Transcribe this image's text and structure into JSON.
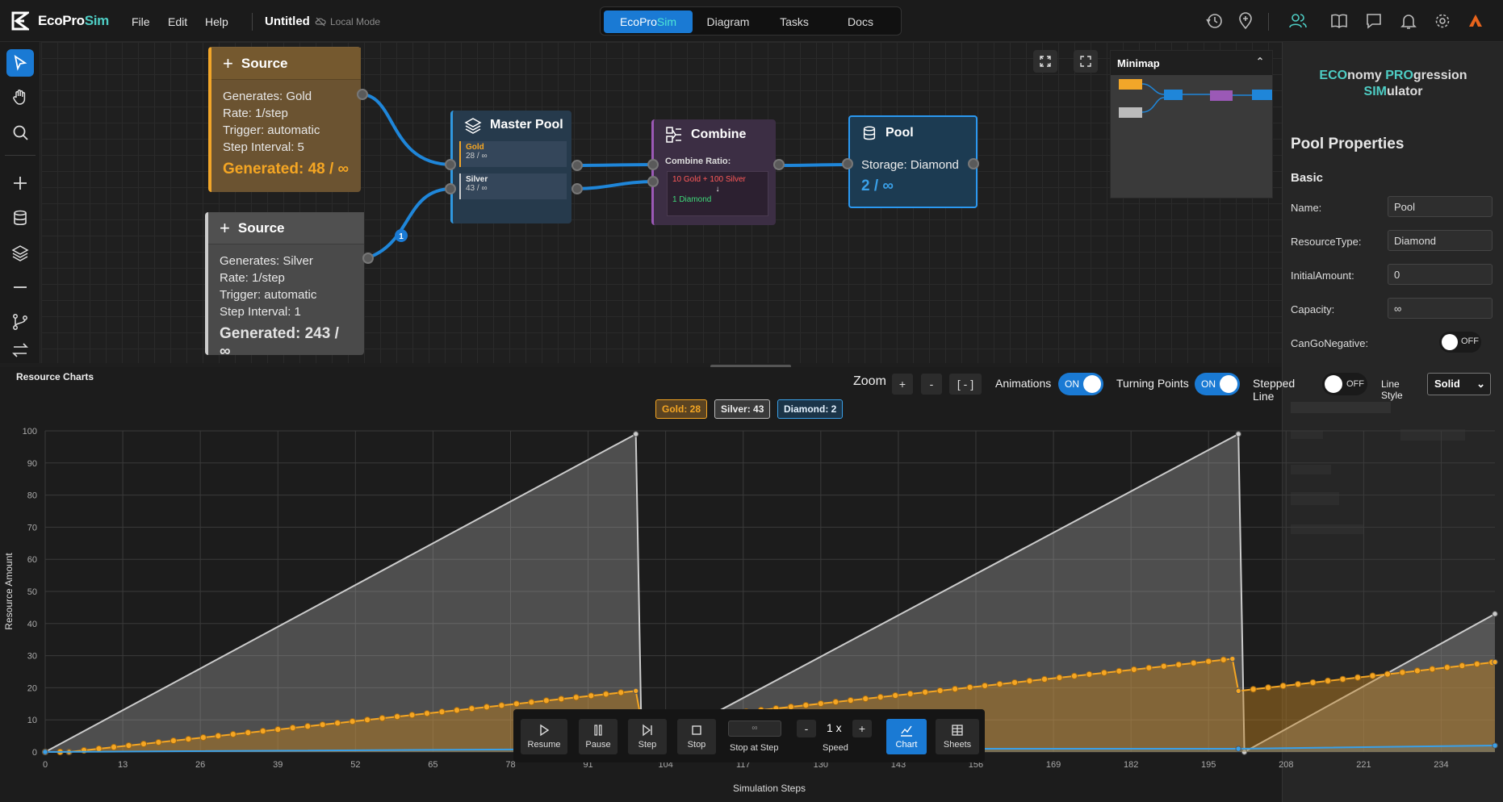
{
  "brand": {
    "name_a": "EcoPro",
    "name_b": "Sim"
  },
  "menu": [
    "File",
    "Edit",
    "Help"
  ],
  "document": {
    "title": "Untitled",
    "mode": "Local Mode"
  },
  "tabs": [
    {
      "label_a": "EcoPro",
      "label_b": "Sim",
      "active": true
    },
    {
      "label": "Diagram"
    },
    {
      "label": "Tasks"
    },
    {
      "label": "Docs"
    }
  ],
  "top_icons": [
    "history-icon",
    "location-icon",
    "users-icon",
    "book-icon",
    "chat-icon",
    "bell-icon",
    "settings-icon",
    "avatar-icon"
  ],
  "left_tools": [
    "pointer-icon",
    "hand-icon",
    "search-icon",
    "plus-icon",
    "database-icon",
    "layers-icon",
    "minus-icon",
    "branch-icon",
    "swap-icon"
  ],
  "nodes": {
    "source_gold": {
      "title": "Source",
      "lines": [
        "Generates: Gold",
        "Rate: 1/step",
        "Trigger: automatic",
        "Step Interval: 5"
      ],
      "generated": "Generated: 48 / ∞"
    },
    "source_silver": {
      "title": "Source",
      "lines": [
        "Generates: Silver",
        "Rate: 1/step",
        "Trigger: automatic",
        "Step Interval: 1"
      ],
      "generated": "Generated: 243 / ∞"
    },
    "master_pool": {
      "title": "Master Pool",
      "slots": [
        {
          "name": "Gold",
          "value": "28 / ∞"
        },
        {
          "name": "Silver",
          "value": "43 / ∞"
        }
      ]
    },
    "combine": {
      "title": "Combine",
      "ratio_label": "Combine Ratio:",
      "input": "10 Gold + 100 Silver",
      "arrow": "↓",
      "output": "1 Diamond"
    },
    "pool": {
      "title": "Pool",
      "storage": "Storage: Diamond",
      "amount": "2 / ∞"
    },
    "wire_badge": "1"
  },
  "minimap": {
    "title": "Minimap"
  },
  "right_panel": {
    "app_title": {
      "p1": "ECO",
      "p2": "nomy ",
      "p3": "PRO",
      "p4": "gression",
      "p5": "SIM",
      "p6": "ulator"
    },
    "section": "Pool Properties",
    "group": "Basic",
    "fields": [
      {
        "label": "Name:",
        "value": "Pool"
      },
      {
        "label": "ResourceType:",
        "value": "Diamond"
      },
      {
        "label": "InitialAmount:",
        "value": "0"
      },
      {
        "label": "Capacity:",
        "value": "∞"
      }
    ],
    "can_go_negative": {
      "label": "CanGoNegative:",
      "state": "OFF"
    }
  },
  "charts_panel": {
    "title": "Resource Charts",
    "zoom_label": "Zoom",
    "zoom_in": "+",
    "zoom_out": "-",
    "zoom_reset": "[ - ]",
    "animations": {
      "label": "Animations",
      "state": "ON"
    },
    "turning_points": {
      "label": "Turning Points",
      "state": "ON"
    },
    "stepped_line": {
      "label": "Stepped Line",
      "state": "OFF"
    },
    "line_style": {
      "label": "Line Style",
      "value": "Solid"
    },
    "legend": [
      {
        "label": "Gold: 28",
        "color": "#f5a623"
      },
      {
        "label": "Silver: 43",
        "color": "#cccccc"
      },
      {
        "label": "Diamond: 2",
        "color": "#3aa0e8"
      }
    ]
  },
  "chart_data": {
    "type": "area",
    "xlabel": "Simulation Steps",
    "ylabel": "Resource Amount",
    "xlim": [
      0,
      243
    ],
    "ylim": [
      0,
      100
    ],
    "xticks": [
      0,
      13,
      26,
      39,
      52,
      65,
      78,
      91,
      104,
      117,
      130,
      143,
      156,
      169,
      182,
      195,
      208,
      221,
      234
    ],
    "yticks": [
      0,
      10,
      20,
      30,
      40,
      50,
      60,
      70,
      80,
      90,
      100
    ],
    "grid": true,
    "series": [
      {
        "name": "Silver",
        "color": "#cccccc",
        "x": [
          0,
          99,
          100,
          200,
          201,
          243
        ],
        "values": [
          0,
          99,
          0,
          99,
          0,
          43
        ]
      },
      {
        "name": "Gold",
        "color": "#f5a623",
        "x": [
          0,
          4,
          99,
          100,
          199,
          200,
          243
        ],
        "values": [
          0,
          0,
          19,
          9,
          29,
          19,
          28
        ]
      },
      {
        "name": "Diamond",
        "color": "#3aa0e8",
        "x": [
          0,
          100,
          200,
          243
        ],
        "values": [
          0,
          1,
          1,
          2
        ]
      }
    ]
  },
  "playback": {
    "resume": "Resume",
    "pause": "Pause",
    "step": "Step",
    "stop": "Stop",
    "stop_at_step_value": "∞",
    "stop_at_step": "Stop at Step",
    "speed_value": "1 x",
    "speed_label": "Speed",
    "speed_minus": "-",
    "speed_plus": "+",
    "chart": "Chart",
    "sheets": "Sheets"
  }
}
